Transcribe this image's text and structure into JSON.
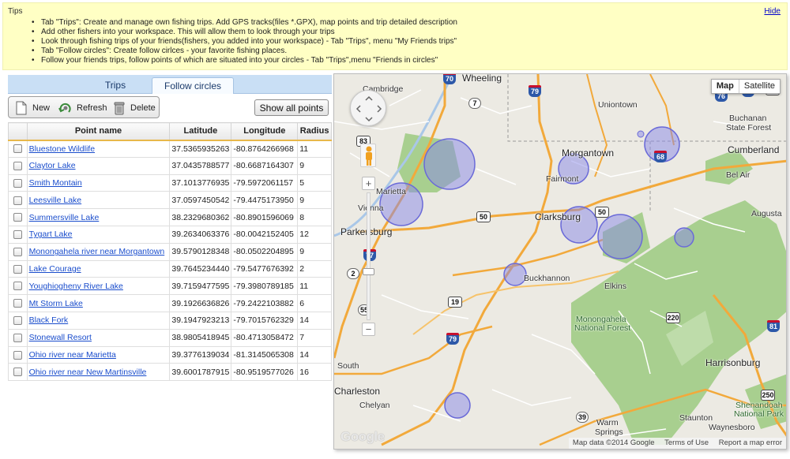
{
  "tips": {
    "title": "Tips",
    "hide_label": "Hide",
    "items": [
      "Tab \"Trips\": Create and manage own fishing trips. Add GPS tracks(files *.GPX), map points and trip detailed description",
      "Add other fishers into your workspace. This will allow them to look through your trips",
      "Look through fishing trips of your friends(fishers, you added into your workspace) - Tab \"Trips\", menu \"My Friends trips\"",
      "Tab \"Follow circles\": Create follow cirlces - your favorite fishing places.",
      "Follow your friends trips, follow points of which are situated into your circles - Tab \"Trips\",menu \"Friends in circles\""
    ]
  },
  "tabs": [
    {
      "label": "Trips",
      "active": false
    },
    {
      "label": "Follow circles",
      "active": true
    }
  ],
  "toolbar": {
    "new_label": "New",
    "refresh_label": "Refresh",
    "delete_label": "Delete",
    "show_all_label": "Show all points"
  },
  "table": {
    "columns": [
      "Point name",
      "Latitude",
      "Longitude",
      "Radius"
    ],
    "rows": [
      {
        "name": "Bluestone Wildlife",
        "lat": "37.5365935263",
        "lon": "-80.8764266968",
        "radius": "11"
      },
      {
        "name": "Claytor Lake",
        "lat": "37.0435788577",
        "lon": "-80.6687164307",
        "radius": "9"
      },
      {
        "name": "Smith Montain",
        "lat": "37.1013776935",
        "lon": "-79.5972061157",
        "radius": "5"
      },
      {
        "name": "Leesville Lake",
        "lat": "37.0597450542",
        "lon": "-79.4475173950",
        "radius": "9"
      },
      {
        "name": "Summersville Lake",
        "lat": "38.2329680362",
        "lon": "-80.8901596069",
        "radius": "8"
      },
      {
        "name": "Tygart Lake",
        "lat": "39.2634063376",
        "lon": "-80.0042152405",
        "radius": "12"
      },
      {
        "name": "Monongahela river near Morgantown",
        "lat": "39.5790128348",
        "lon": "-80.0502204895",
        "radius": "9"
      },
      {
        "name": "Lake Courage",
        "lat": "39.7645234440",
        "lon": "-79.5477676392",
        "radius": "2"
      },
      {
        "name": "Youghiogheny River Lake",
        "lat": "39.7159477595",
        "lon": "-79.3980789185",
        "radius": "11"
      },
      {
        "name": "Mt Storm Lake",
        "lat": "39.1926636826",
        "lon": "-79.2422103882",
        "radius": "6"
      },
      {
        "name": "Black Fork",
        "lat": "39.1947923213",
        "lon": "-79.7015762329",
        "radius": "14"
      },
      {
        "name": "Stonewall Resort",
        "lat": "38.9805418945",
        "lon": "-80.4713058472",
        "radius": "7"
      },
      {
        "name": "Ohio river near Marietta",
        "lat": "39.3776139034",
        "lon": "-81.3145065308",
        "radius": "14"
      },
      {
        "name": "Ohio river near New Martinsville",
        "lat": "39.6001787915",
        "lon": "-80.9519577026",
        "radius": "16"
      }
    ]
  },
  "map": {
    "type_map": "Map",
    "type_satellite": "Satellite",
    "logo": "Google",
    "attribution": {
      "data": "Map data ©2014 Google",
      "terms": "Terms of Use",
      "report": "Report a map error"
    },
    "places": {
      "cambridge": "Cambridge",
      "wheeling": "Wheeling",
      "uniontown": "Uniontown",
      "buchanan": "Buchanan",
      "state_forest": "State Forest",
      "morgantown": "Morgantown",
      "cumberland": "Cumberland",
      "marietta": "Marietta",
      "fairmont": "Fairmont",
      "bel_air": "Bel Air",
      "vienna": "Vienna",
      "clarksburg": "Clarksburg",
      "augusta": "Augusta",
      "parkersburg": "Parkersburg",
      "buckhannon": "Buckhannon",
      "elkins": "Elkins",
      "monongahela": "Monongahela",
      "national_forest": "National Forest",
      "south": "South",
      "charleston": "Charleston",
      "harrisonburg": "Harrisonburg",
      "chelyan": "Chelyan",
      "warm": "Warm",
      "springs": "Springs",
      "staunton": "Staunton",
      "shenandoah": "Shenandoah",
      "national_park": "National Park",
      "waynesboro": "Waynesboro"
    },
    "shields": [
      "70",
      "79",
      "7",
      "76",
      "83",
      "68",
      "50",
      "50",
      "77",
      "2",
      "55",
      "19",
      "79",
      "220",
      "81",
      "39",
      "250",
      "68",
      "40"
    ],
    "colors": {
      "circle_fill": "#8888e8",
      "circle_stroke": "#6a6ad8",
      "forest": "#a8cf8f",
      "land": "#eceae3",
      "major_road": "#f2a93b"
    }
  }
}
